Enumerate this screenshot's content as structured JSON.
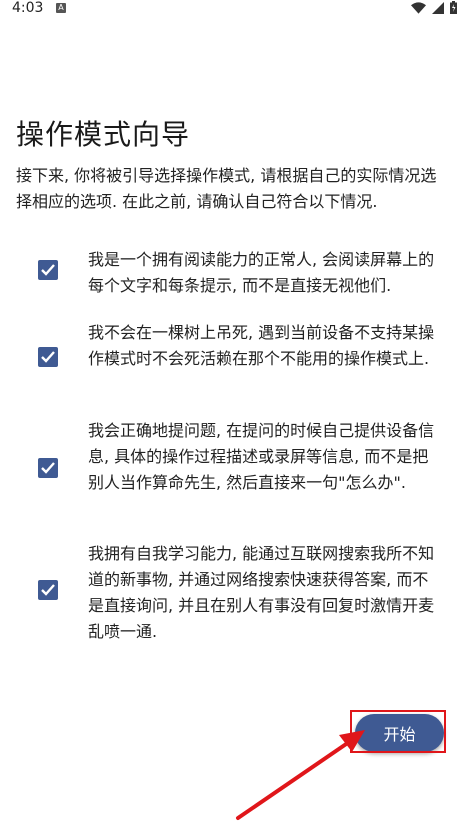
{
  "status_bar": {
    "time": "4:03",
    "notification_icon": "A",
    "icons": [
      "wifi-icon",
      "signal-icon",
      "battery-icon"
    ]
  },
  "title": "操作模式向导",
  "intro": "接下来, 你将被引导选择操作模式, 请根据自己的实际情况选择相应的选项. 在此之前, 请确认自己符合以下情况.",
  "items": [
    {
      "text": "我是一个拥有阅读能力的正常人, 会阅读屏幕上的每个文字和每条提示, 而不是直接无视他们.",
      "checked": true
    },
    {
      "text": "我不会在一棵树上吊死, 遇到当前设备不支持某操作模式时不会死活赖在那个不能用的操作模式上.",
      "checked": true
    },
    {
      "text": "我会正确地提问题, 在提问的时候自己提供设备信息, 具体的操作过程描述或录屏等信息, 而不是把别人当作算命先生, 然后直接来一句\"怎么办\".",
      "checked": true
    },
    {
      "text": "我拥有自我学习能力, 能通过互联网搜索我所不知道的新事物, 并通过网络搜索快速获得答案, 而不是直接询问, 并且在别人有事没有回复时激情开麦乱喷一通.",
      "checked": true
    }
  ],
  "start_button": {
    "label": "开始"
  },
  "colors": {
    "accent": "#3f5a93",
    "annotation": "#e0161a"
  }
}
